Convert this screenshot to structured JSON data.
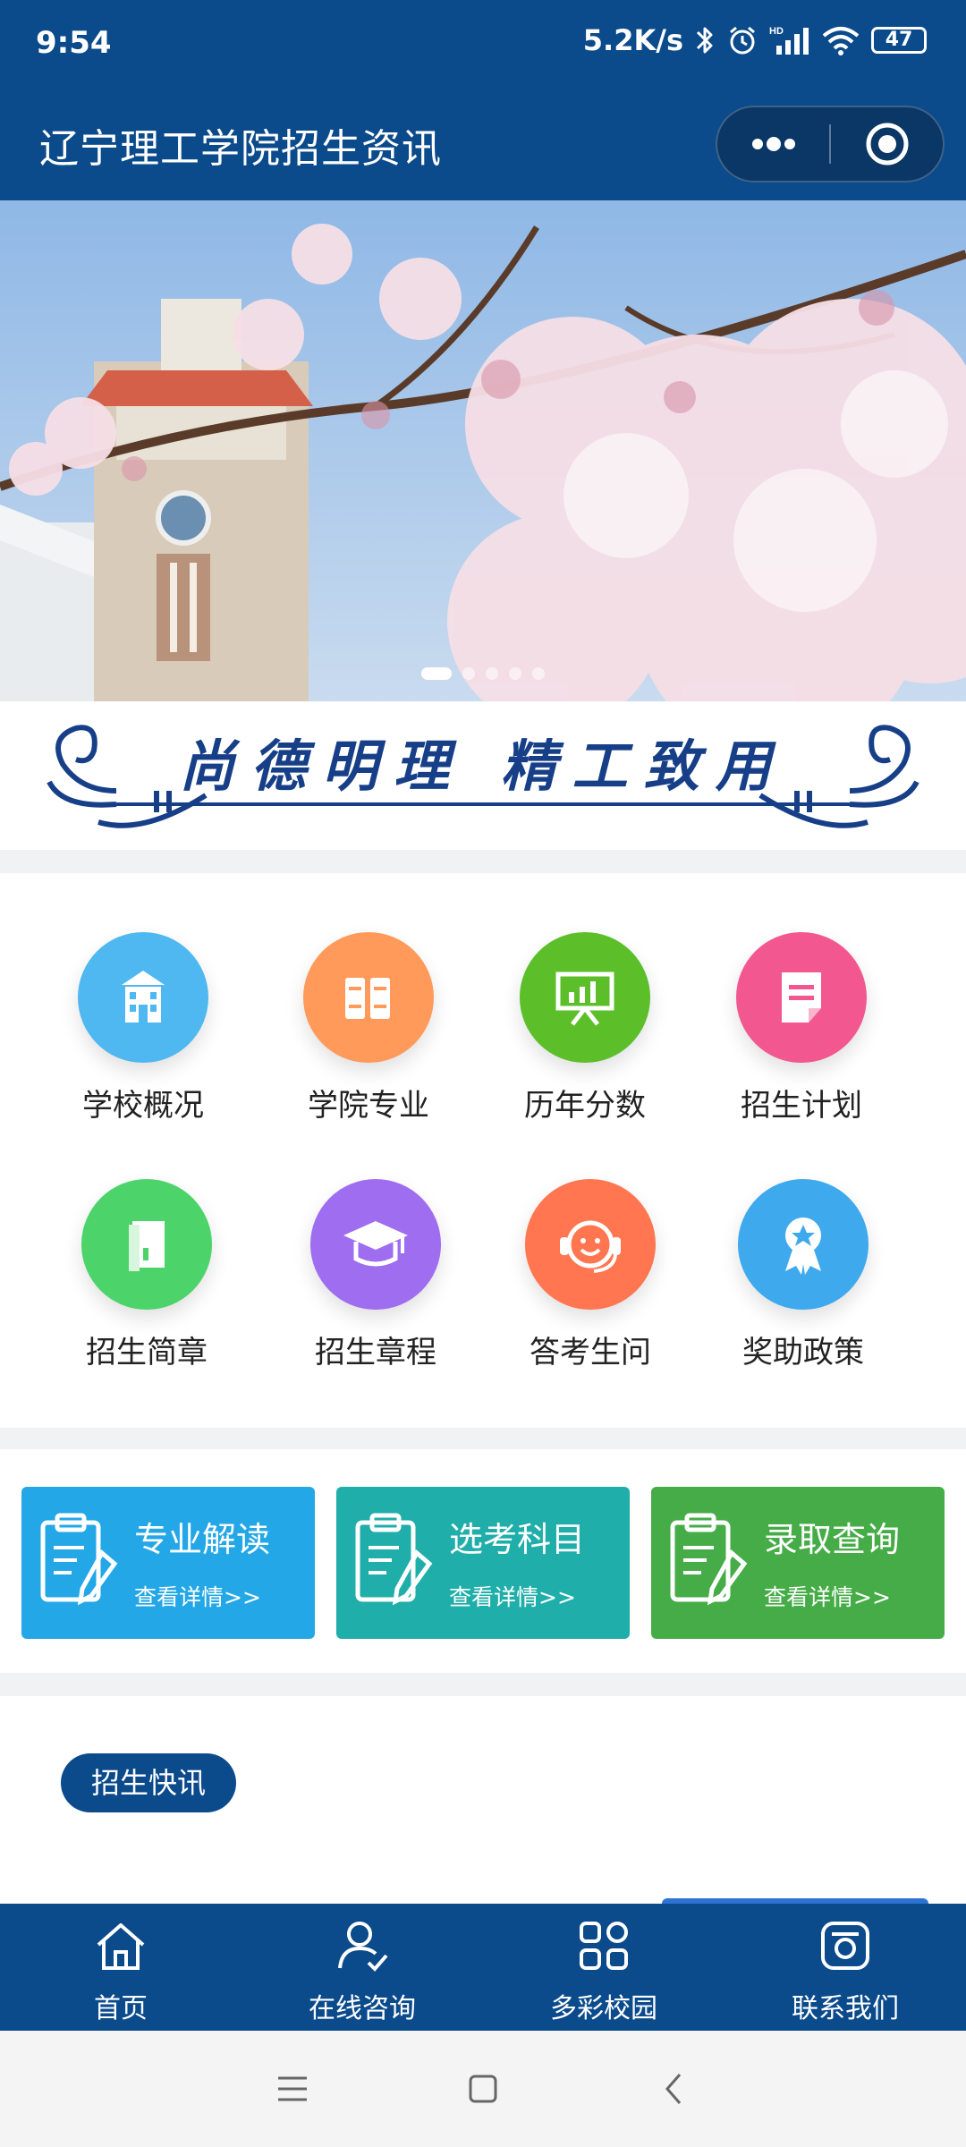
{
  "status_bar": {
    "time": "9:54",
    "net_speed": "5.2K/s",
    "hd": "HD",
    "battery": "47",
    "icons": [
      "bluetooth-icon",
      "alarm-icon",
      "signal-icon",
      "wifi-icon",
      "battery-icon"
    ]
  },
  "header": {
    "title": "辽宁理工学院招生资讯",
    "menu_icon": "more-dots-icon",
    "close_icon": "target-circle-icon"
  },
  "banner": {
    "slides": 5,
    "active_index": 0
  },
  "motto": {
    "text": "尚德明理 精工致用"
  },
  "grid": [
    {
      "label": "学校概况",
      "icon": "school-building-icon",
      "color": "#4fb8f0"
    },
    {
      "label": "学院专业",
      "icon": "books-icon",
      "color": "#ff9a5a"
    },
    {
      "label": "历年分数",
      "icon": "presentation-board-icon",
      "color": "#5cbf2a"
    },
    {
      "label": "招生计划",
      "icon": "document-icon",
      "color": "#f2588f"
    },
    {
      "label": "招生简章",
      "icon": "brochure-icon",
      "color": "#4cd46a"
    },
    {
      "label": "招生章程",
      "icon": "graduation-cap-icon",
      "color": "#9f6df0"
    },
    {
      "label": "答考生问",
      "icon": "customer-service-icon",
      "color": "#ff7650"
    },
    {
      "label": "奖助政策",
      "icon": "award-ribbon-icon",
      "color": "#3fa9ee"
    }
  ],
  "cards": [
    {
      "title": "专业解读",
      "subtitle": "查看详情>>",
      "color": "#23a7e7",
      "icon": "clipboard-pen-icon"
    },
    {
      "title": "选考科目",
      "subtitle": "查看详情>>",
      "color": "#1faea9",
      "icon": "clipboard-pen-icon"
    },
    {
      "title": "录取查询",
      "subtitle": "查看详情>>",
      "color": "#46ac47",
      "icon": "clipboard-pen-icon"
    }
  ],
  "news": {
    "label": "招生快讯"
  },
  "tabbar": [
    {
      "label": "首页",
      "icon": "home-icon"
    },
    {
      "label": "在线咨询",
      "icon": "user-check-icon"
    },
    {
      "label": "多彩校园",
      "icon": "grid-apps-icon"
    },
    {
      "label": "联系我们",
      "icon": "contact-icon"
    }
  ],
  "system_nav": [
    "menu-icon",
    "home-square-icon",
    "back-icon"
  ]
}
